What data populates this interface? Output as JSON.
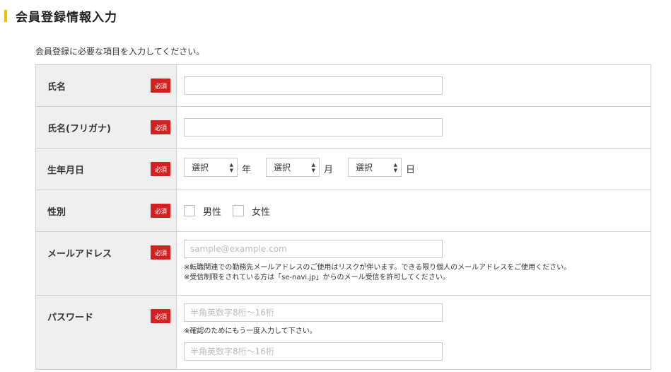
{
  "header": {
    "title": "会員登録情報入力"
  },
  "intro": "会員登録に必要な項目を入力してください。",
  "required_badge": "必須",
  "fields": {
    "name": {
      "label": "氏名",
      "value": ""
    },
    "kana": {
      "label": "氏名(フリガナ)",
      "value": ""
    },
    "birthday": {
      "label": "生年月日",
      "year": {
        "selected": "選択",
        "unit": "年"
      },
      "month": {
        "selected": "選択",
        "unit": "月"
      },
      "day": {
        "selected": "選択",
        "unit": "日"
      }
    },
    "gender": {
      "label": "性別",
      "options": [
        {
          "label": "男性",
          "checked": false
        },
        {
          "label": "女性",
          "checked": false
        }
      ]
    },
    "email": {
      "label": "メールアドレス",
      "placeholder": "sample@example.com",
      "notes": [
        "※転職関連での勤務先メールアドレスのご使用はリスクが伴います。できる限り個人のメールアドレスをご使用ください。",
        "※受信制限をされている方は「se-navi.jp」からのメール受信を許可してください。"
      ]
    },
    "password": {
      "label": "パスワード",
      "placeholder": "半角英数字8桁〜16桁",
      "confirm_note": "※確認のためにもう一度入力して下さい。",
      "confirm_placeholder": "半角英数字8桁〜16桁"
    }
  }
}
